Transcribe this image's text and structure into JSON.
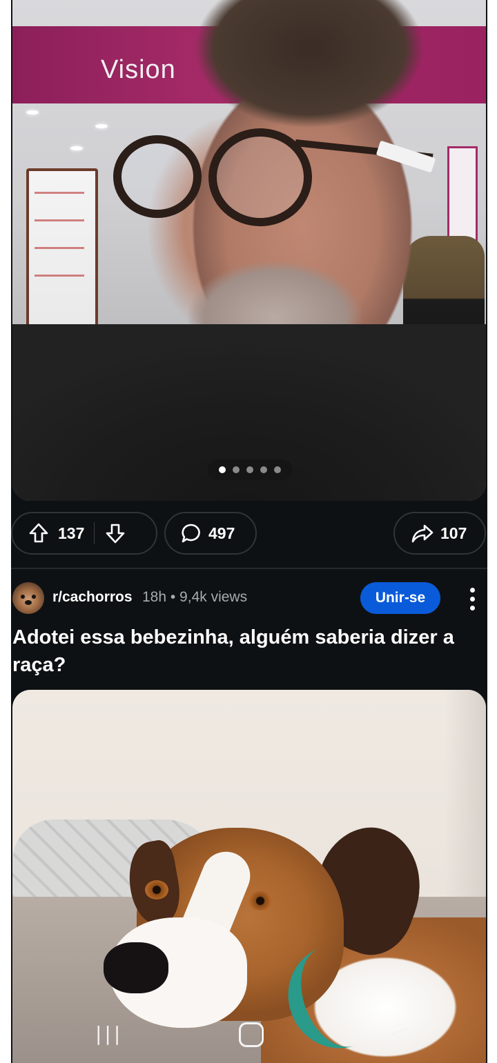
{
  "post1": {
    "image_alt": "",
    "store_sign": "Vision",
    "carousel": {
      "count": 5,
      "active_index": 0
    },
    "actions": {
      "upvotes": "137",
      "comments": "497",
      "shares": "107"
    }
  },
  "post2": {
    "subreddit": "r/cachorros",
    "meta": "18h • 9,4k views",
    "join_label": "Unir-se",
    "title": "Adotei essa bebezinha, alguém saberia dizer a raça?"
  },
  "nav": {
    "recents_glyph": "|||",
    "back_glyph": "<"
  },
  "icons": [
    "upvote-icon",
    "downvote-icon",
    "comment-icon",
    "share-icon",
    "more-icon",
    "recents-icon",
    "home-icon",
    "back-icon"
  ],
  "colors": {
    "background": "#0e1113",
    "join_button": "#0a5bd9",
    "meta_text": "#a6acb0"
  }
}
